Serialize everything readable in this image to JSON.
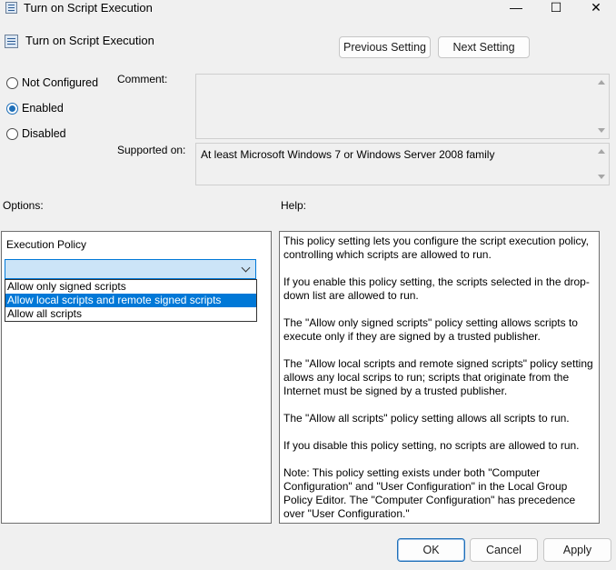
{
  "window": {
    "title": "Turn on Script Execution",
    "controls": {
      "minimize": "—",
      "maximize": "☐",
      "close": "✕"
    }
  },
  "header": {
    "policy_name": "Turn on Script Execution",
    "prev_button": "Previous Setting",
    "next_button": "Next Setting"
  },
  "state": {
    "options": [
      {
        "label": "Not Configured",
        "checked": false
      },
      {
        "label": "Enabled",
        "checked": true
      },
      {
        "label": "Disabled",
        "checked": false
      }
    ]
  },
  "comment": {
    "label": "Comment:",
    "value": ""
  },
  "supported": {
    "label": "Supported on:",
    "value": "At least Microsoft Windows 7 or Windows Server 2008 family"
  },
  "options_section": {
    "heading": "Options:",
    "field_label": "Execution Policy",
    "selected_value": "",
    "dropdown_items": [
      {
        "label": "Allow only signed scripts",
        "highlighted": false
      },
      {
        "label": "Allow local scripts and remote signed scripts",
        "highlighted": true
      },
      {
        "label": "Allow all scripts",
        "highlighted": false
      }
    ]
  },
  "help_section": {
    "heading": "Help:",
    "paragraphs": [
      "This policy setting lets you configure the script execution policy, controlling which scripts are allowed to run.",
      "If you enable this policy setting, the scripts selected in the drop-down list are allowed to run.",
      "The \"Allow only signed scripts\" policy setting allows scripts to execute only if they are signed by a trusted publisher.",
      "The \"Allow local scripts and remote signed scripts\" policy setting allows any local scrips to run; scripts that originate from the Internet must be signed by a trusted publisher.",
      "The \"Allow all scripts\" policy setting allows all scripts to run.",
      "If you disable this policy setting, no scripts are allowed to run.",
      "Note: This policy setting exists under both \"Computer Configuration\" and \"User Configuration\" in the Local Group Policy Editor. The \"Computer Configuration\" has precedence over \"User Configuration.\""
    ]
  },
  "footer": {
    "ok": "OK",
    "cancel": "Cancel",
    "apply": "Apply"
  },
  "colors": {
    "accent": "#0078d7",
    "selection_bg": "#cce4f7",
    "dialog_bg": "#f0f0f0"
  }
}
